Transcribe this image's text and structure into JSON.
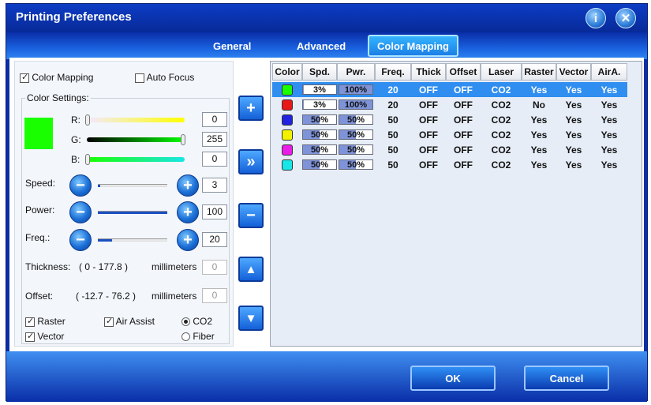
{
  "window": {
    "title": "Printing Preferences",
    "info_icon": "info-icon",
    "close_icon": "close-icon"
  },
  "tabs": [
    {
      "label": "General",
      "active": false
    },
    {
      "label": "Advanced",
      "active": false
    },
    {
      "label": "Color Mapping",
      "active": true
    }
  ],
  "left": {
    "color_mapping_label": "Color Mapping",
    "color_mapping_checked": true,
    "auto_focus_label": "Auto Focus",
    "auto_focus_checked": false,
    "color_settings_label": "Color Settings:",
    "preview_color": "#19ff00",
    "r_label": "R:",
    "g_label": "G:",
    "b_label": "B:",
    "r_value": "0",
    "g_value": "255",
    "b_value": "0",
    "speed_label": "Speed:",
    "speed_value": "3",
    "power_label": "Power:",
    "power_value": "100",
    "freq_label": "Freq.:",
    "freq_value": "20",
    "thickness_label": "Thickness:",
    "thickness_range": "( 0  -  177.8 )",
    "thickness_unit": "millimeters",
    "thickness_value": "0",
    "offset_label": "Offset:",
    "offset_range": "( -12.7  -  76.2 )",
    "offset_unit": "millimeters",
    "offset_value": "0",
    "raster_label": "Raster",
    "vector_label": "Vector",
    "air_assist_label": "Air Assist",
    "co2_label": "CO2",
    "fiber_label": "Fiber",
    "minus_sign": "−",
    "plus_sign": "+"
  },
  "side_buttons": {
    "add": "+",
    "forward": "»",
    "remove": "−",
    "up": "▲",
    "down": "▼"
  },
  "table": {
    "headers": [
      "Color",
      "Spd.",
      "Pwr.",
      "Freq.",
      "Thick",
      "Offset",
      "Laser",
      "Raster",
      "Vector",
      "AirA."
    ],
    "rows": [
      {
        "color": "#19ff00",
        "spd": "3%",
        "pwr": "100%",
        "freq": "20",
        "thick": "OFF",
        "offset": "OFF",
        "laser": "CO2",
        "raster": "Yes",
        "vector": "Yes",
        "aira": "Yes",
        "selected": true
      },
      {
        "color": "#e61818",
        "spd": "3%",
        "pwr": "100%",
        "freq": "20",
        "thick": "OFF",
        "offset": "OFF",
        "laser": "CO2",
        "raster": "No",
        "vector": "Yes",
        "aira": "Yes",
        "selected": false
      },
      {
        "color": "#2121e0",
        "spd": "50%",
        "pwr": "50%",
        "freq": "50",
        "thick": "OFF",
        "offset": "OFF",
        "laser": "CO2",
        "raster": "Yes",
        "vector": "Yes",
        "aira": "Yes",
        "selected": false
      },
      {
        "color": "#f2f200",
        "spd": "50%",
        "pwr": "50%",
        "freq": "50",
        "thick": "OFF",
        "offset": "OFF",
        "laser": "CO2",
        "raster": "Yes",
        "vector": "Yes",
        "aira": "Yes",
        "selected": false
      },
      {
        "color": "#e81ee8",
        "spd": "50%",
        "pwr": "50%",
        "freq": "50",
        "thick": "OFF",
        "offset": "OFF",
        "laser": "CO2",
        "raster": "Yes",
        "vector": "Yes",
        "aira": "Yes",
        "selected": false
      },
      {
        "color": "#17e6e6",
        "spd": "50%",
        "pwr": "50%",
        "freq": "50",
        "thick": "OFF",
        "offset": "OFF",
        "laser": "CO2",
        "raster": "Yes",
        "vector": "Yes",
        "aira": "Yes",
        "selected": false
      }
    ]
  },
  "footer": {
    "ok_label": "OK",
    "cancel_label": "Cancel"
  }
}
